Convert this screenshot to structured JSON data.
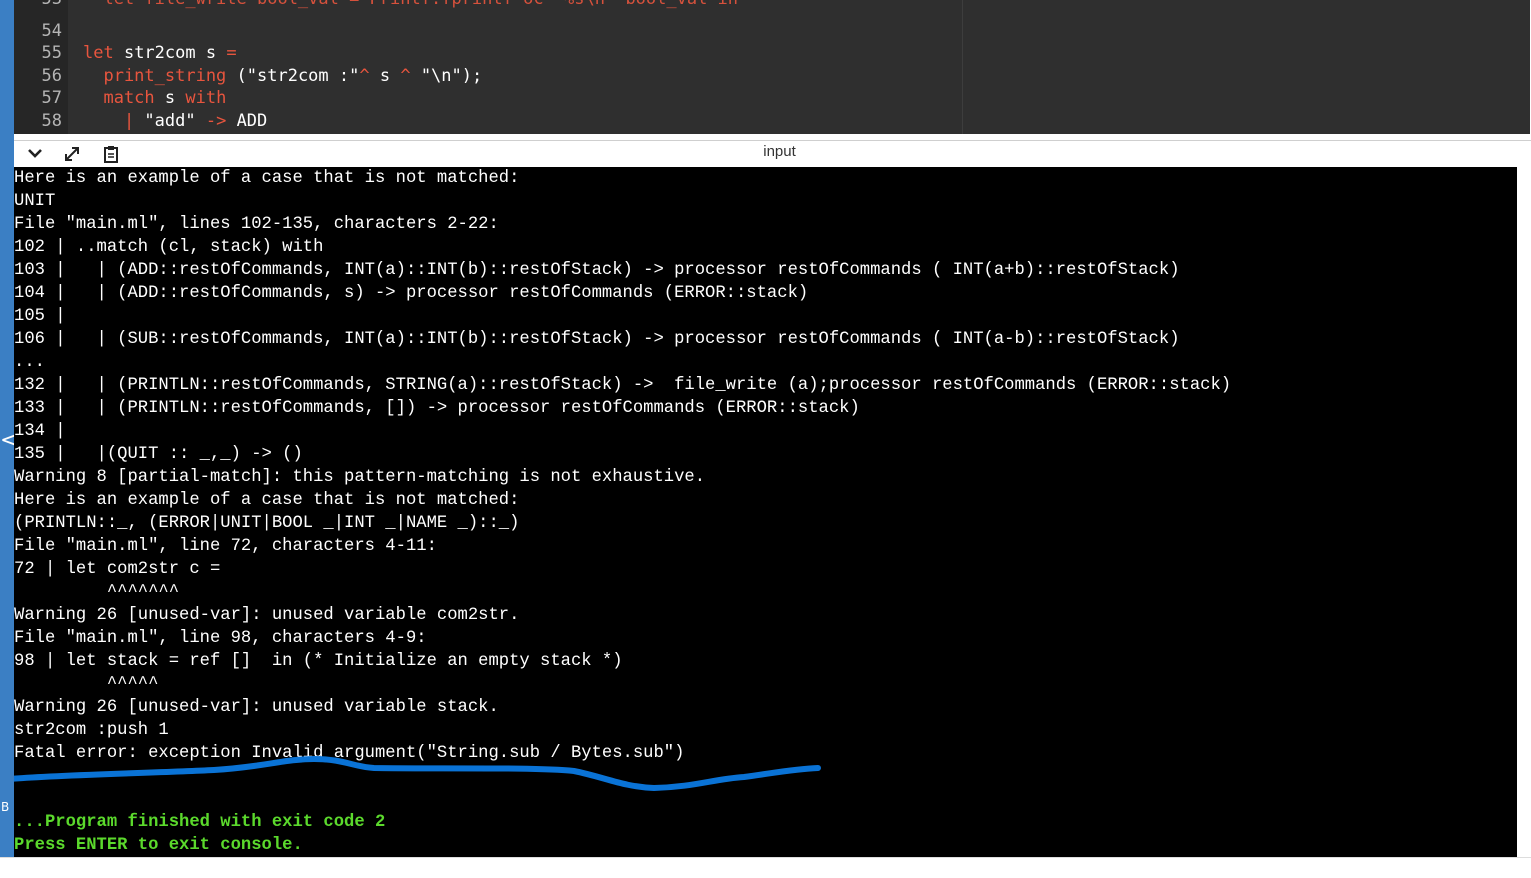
{
  "editor": {
    "lines": [
      {
        "num": "53",
        "segments": [
          {
            "t": "  let file_write bool_val = Printf.fprintf oc \"%s\\n\" bool_val in",
            "c": "partial"
          }
        ]
      },
      {
        "num": "54",
        "segments": []
      },
      {
        "num": "55",
        "segments": [
          {
            "t": "let ",
            "c": "kw"
          },
          {
            "t": "str2com s ",
            "c": ""
          },
          {
            "t": "=",
            "c": "kw"
          }
        ]
      },
      {
        "num": "56",
        "segments": [
          {
            "t": "  print_string",
            "c": "fn"
          },
          {
            "t": " (\"str2com :\"",
            "c": ""
          },
          {
            "t": "^",
            "c": "kw"
          },
          {
            "t": " s ",
            "c": ""
          },
          {
            "t": "^",
            "c": "kw"
          },
          {
            "t": " \"\\n\");",
            "c": ""
          }
        ]
      },
      {
        "num": "57",
        "segments": [
          {
            "t": "  match",
            "c": "kw"
          },
          {
            "t": " s ",
            "c": ""
          },
          {
            "t": "with",
            "c": "kw"
          }
        ]
      },
      {
        "num": "58",
        "segments": [
          {
            "t": "    | ",
            "c": "kw"
          },
          {
            "t": "\"add\"",
            "c": ""
          },
          {
            "t": " -> ",
            "c": "kw"
          },
          {
            "t": "ADD",
            "c": ""
          }
        ]
      }
    ]
  },
  "toolbar": {
    "title": "input",
    "icons": [
      "chevron-down-icon",
      "expand-icon",
      "clipboard-icon"
    ]
  },
  "console": {
    "lines": [
      {
        "text": "Here is an example of a case that is not matched:"
      },
      {
        "text": "UNIT"
      },
      {
        "text": "File \"main.ml\", lines 102-135, characters 2-22:"
      },
      {
        "text": "102 | ..match (cl, stack) with"
      },
      {
        "text": "103 |   | (ADD::restOfCommands, INT(a)::INT(b)::restOfStack) -> processor restOfCommands ( INT(a+b)::restOfStack)"
      },
      {
        "text": "104 |   | (ADD::restOfCommands, s) -> processor restOfCommands (ERROR::stack)"
      },
      {
        "text": "105 |"
      },
      {
        "text": "106 |   | (SUB::restOfCommands, INT(a)::INT(b)::restOfStack) -> processor restOfCommands ( INT(a-b)::restOfStack)"
      },
      {
        "text": "..."
      },
      {
        "text": "132 |   | (PRINTLN::restOfCommands, STRING(a)::restOfStack) ->  file_write (a);processor restOfCommands (ERROR::stack)"
      },
      {
        "text": "133 |   | (PRINTLN::restOfCommands, []) -> processor restOfCommands (ERROR::stack)"
      },
      {
        "text": "134 |"
      },
      {
        "text": "135 |   |(QUIT :: _,_) -> ()"
      },
      {
        "text": "Warning 8 [partial-match]: this pattern-matching is not exhaustive."
      },
      {
        "text": "Here is an example of a case that is not matched:"
      },
      {
        "text": "(PRINTLN::_, (ERROR|UNIT|BOOL _|INT _|NAME _)::_)"
      },
      {
        "text": "File \"main.ml\", line 72, characters 4-11:"
      },
      {
        "text": "72 | let com2str c ="
      },
      {
        "text": "         ^^^^^^^"
      },
      {
        "text": "Warning 26 [unused-var]: unused variable com2str."
      },
      {
        "text": "File \"main.ml\", line 98, characters 4-9:"
      },
      {
        "text": "98 | let stack = ref []  in (* Initialize an empty stack *)"
      },
      {
        "text": "         ^^^^^"
      },
      {
        "text": "Warning 26 [unused-var]: unused variable stack."
      },
      {
        "text": "str2com :push 1"
      },
      {
        "text": "Fatal error: exception Invalid_argument(\"String.sub / Bytes.sub\")"
      },
      {
        "text": ""
      },
      {
        "text": ""
      },
      {
        "text": "...Program finished with exit code 2",
        "style": "green"
      },
      {
        "text": "Press ENTER to exit console.",
        "style": "green"
      }
    ]
  },
  "left_strip": {
    "glyph": "<",
    "letter": "B"
  },
  "colors": {
    "keyword": "#e8553e",
    "console_bg": "#000000",
    "console_green": "#5bd92c",
    "annotation_blue": "#0a73d6"
  }
}
